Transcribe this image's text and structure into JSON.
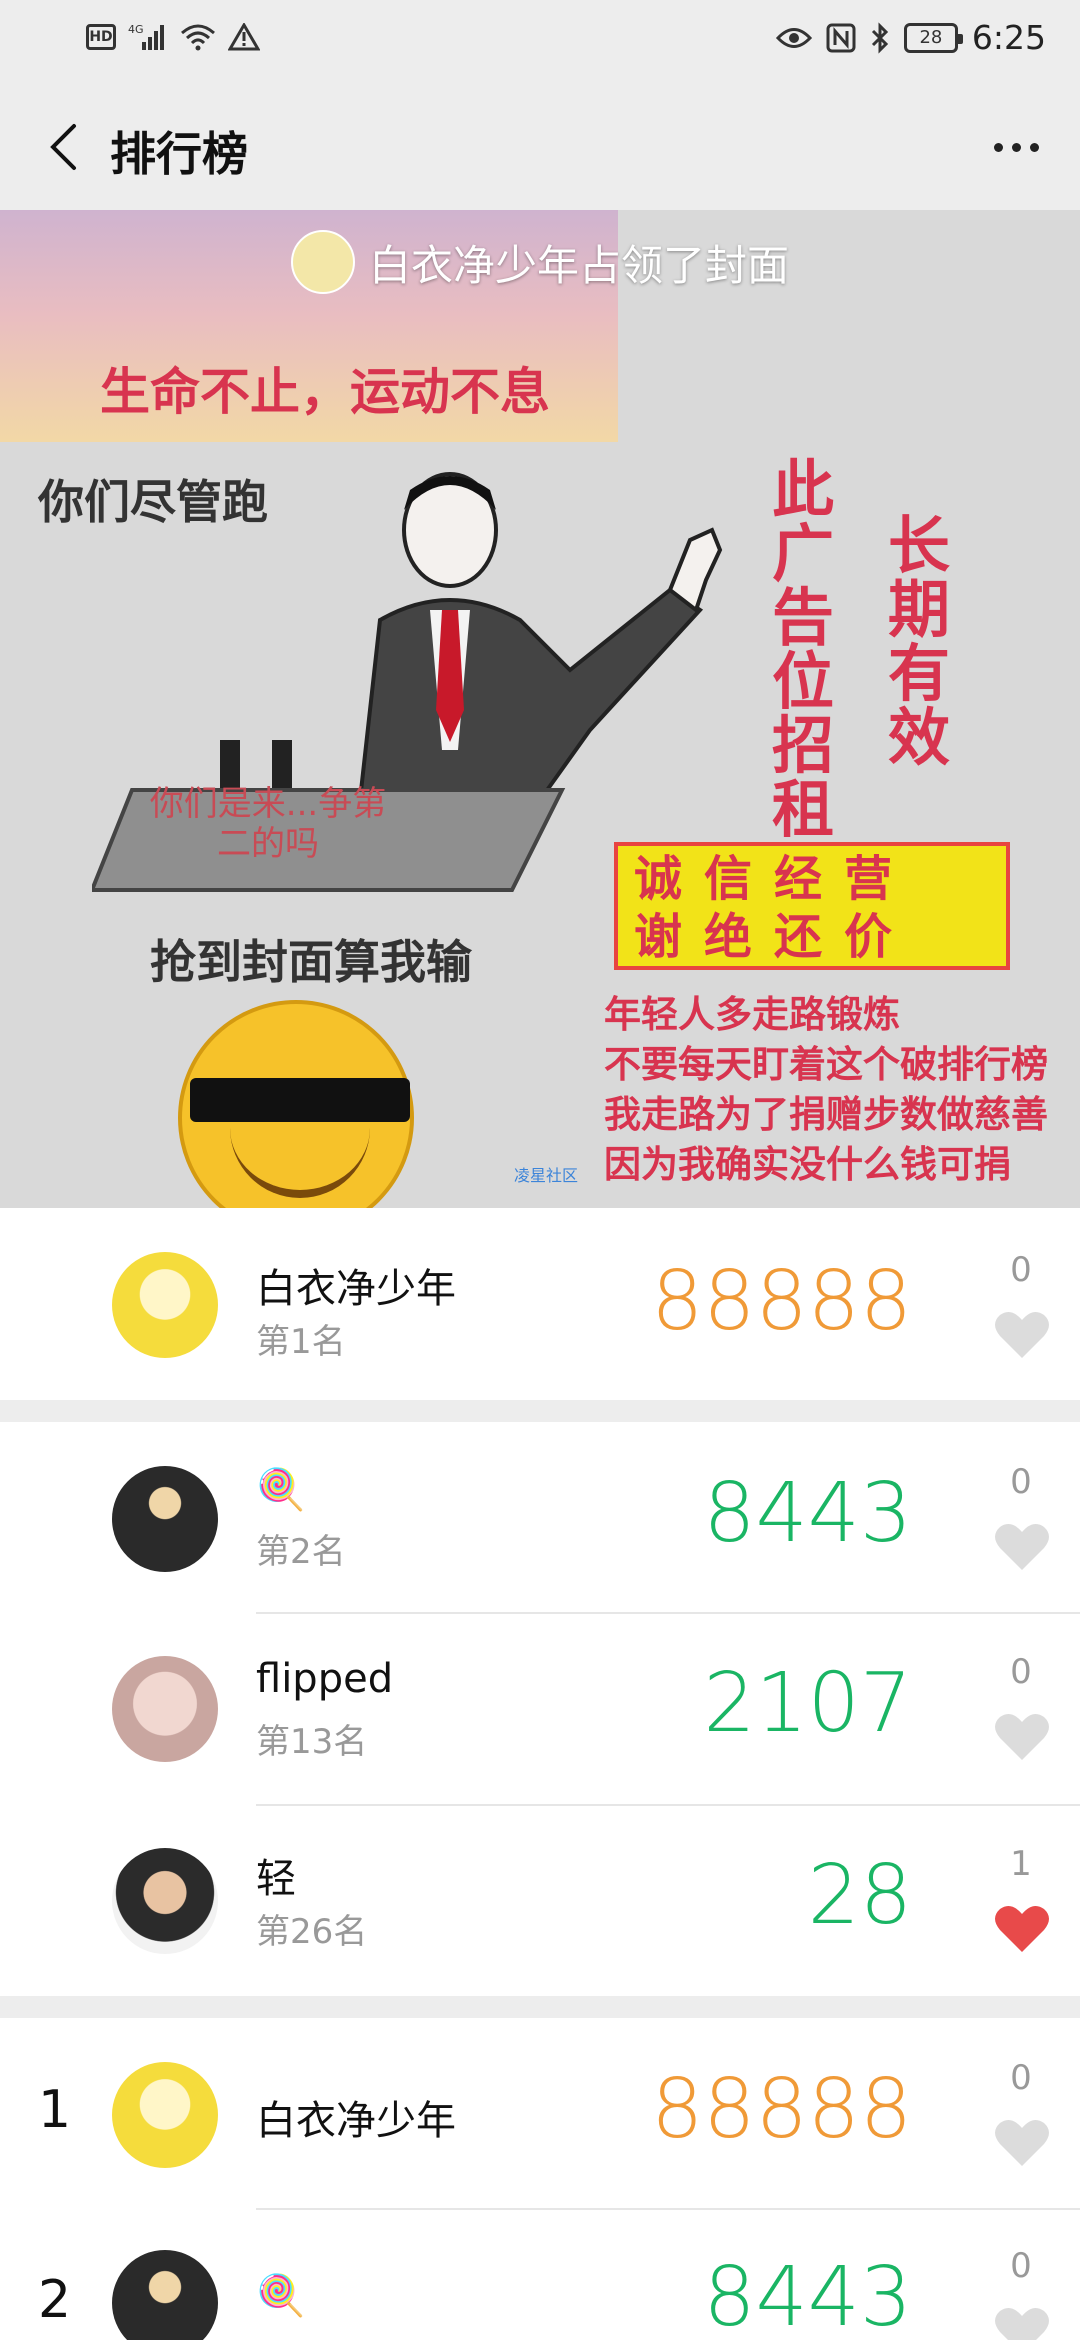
{
  "status_bar": {
    "time": "6:25",
    "battery": "28",
    "network": "4G"
  },
  "header": {
    "title": "排行榜"
  },
  "cover": {
    "owner_text": "白衣净少年占领了封面",
    "banner": "生命不止，运动不息",
    "text_run": "你们尽管跑",
    "text_podium": "你们是来...争第二的吗",
    "text_grab": "抢到封面算我输",
    "vertical_1": "此广告位招租",
    "vertical_2": "长期有效",
    "box_line1": "诚信经营",
    "box_line2": "谢绝还价",
    "red_lines": [
      "年轻人多走路锻炼",
      "不要每天盯着这个破排行榜",
      "我走路为了捐赠步数做慈善",
      "因为我确实没什么钱可捐"
    ],
    "watermark": "凌星社区"
  },
  "my_rank": {
    "name": "白衣净少年",
    "rank_label": "第1名",
    "steps": "88888",
    "likes": "0"
  },
  "friends": [
    {
      "name": "🍭",
      "rank_label": "第2名",
      "steps": "8443",
      "likes": "0",
      "liked": false
    },
    {
      "name": "flipped",
      "rank_label": "第13名",
      "steps": "2107",
      "likes": "0",
      "liked": false
    },
    {
      "name": "轻",
      "rank_label": "第26名",
      "steps": "28",
      "likes": "1",
      "liked": true
    }
  ],
  "leaderboard": [
    {
      "rank": "1",
      "name": "白衣净少年",
      "steps": "88888",
      "likes": "0"
    },
    {
      "rank": "2",
      "name": "🍭",
      "steps": "8443",
      "likes": "0"
    }
  ],
  "colors": {
    "orange": "#f09a37",
    "green": "#1ab564",
    "heart_off": "#dcdcdc",
    "heart_on": "#e84a4a"
  }
}
